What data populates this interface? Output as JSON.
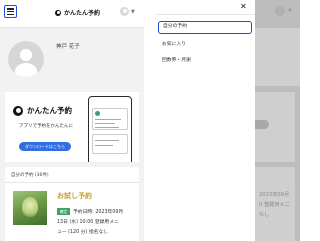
{
  "header": {
    "brand": "かんたん予約"
  },
  "profile": {
    "name": "神戸 花子"
  },
  "promo": {
    "brand": "かんたん予約",
    "tagline": "アプリで予約をかんたんに",
    "download_label": "ダウンロードはこちら"
  },
  "my_reservations": {
    "heading": "自分の予約 (36件)",
    "items": [
      {
        "title": "お試し予約",
        "status": "確定",
        "line1": "予約日時: 2023年09月",
        "line2": "13日 (水) 10:00 登録用メニ",
        "line3": "ュー (120 分) 指名なし"
      }
    ]
  },
  "drawer": {
    "items": [
      {
        "label": "自分の予約",
        "active": true
      },
      {
        "label": "お気に入り",
        "active": false
      },
      {
        "label": "回数券・月謝",
        "active": false
      }
    ]
  },
  "overlay": {
    "lines": [
      "2023年09月",
      "0 登録用メニ",
      "なし"
    ]
  },
  "colors": {
    "accent_blue": "#1f4fd8",
    "download_blue": "#2f6fe0",
    "status_green": "#3aa26b",
    "title_gold": "#c9a227"
  },
  "icons": {
    "menu": "hamburger-menu-icon",
    "close": "close-icon",
    "avatar": "user-avatar-icon",
    "chevron": "chevron-down-icon"
  }
}
